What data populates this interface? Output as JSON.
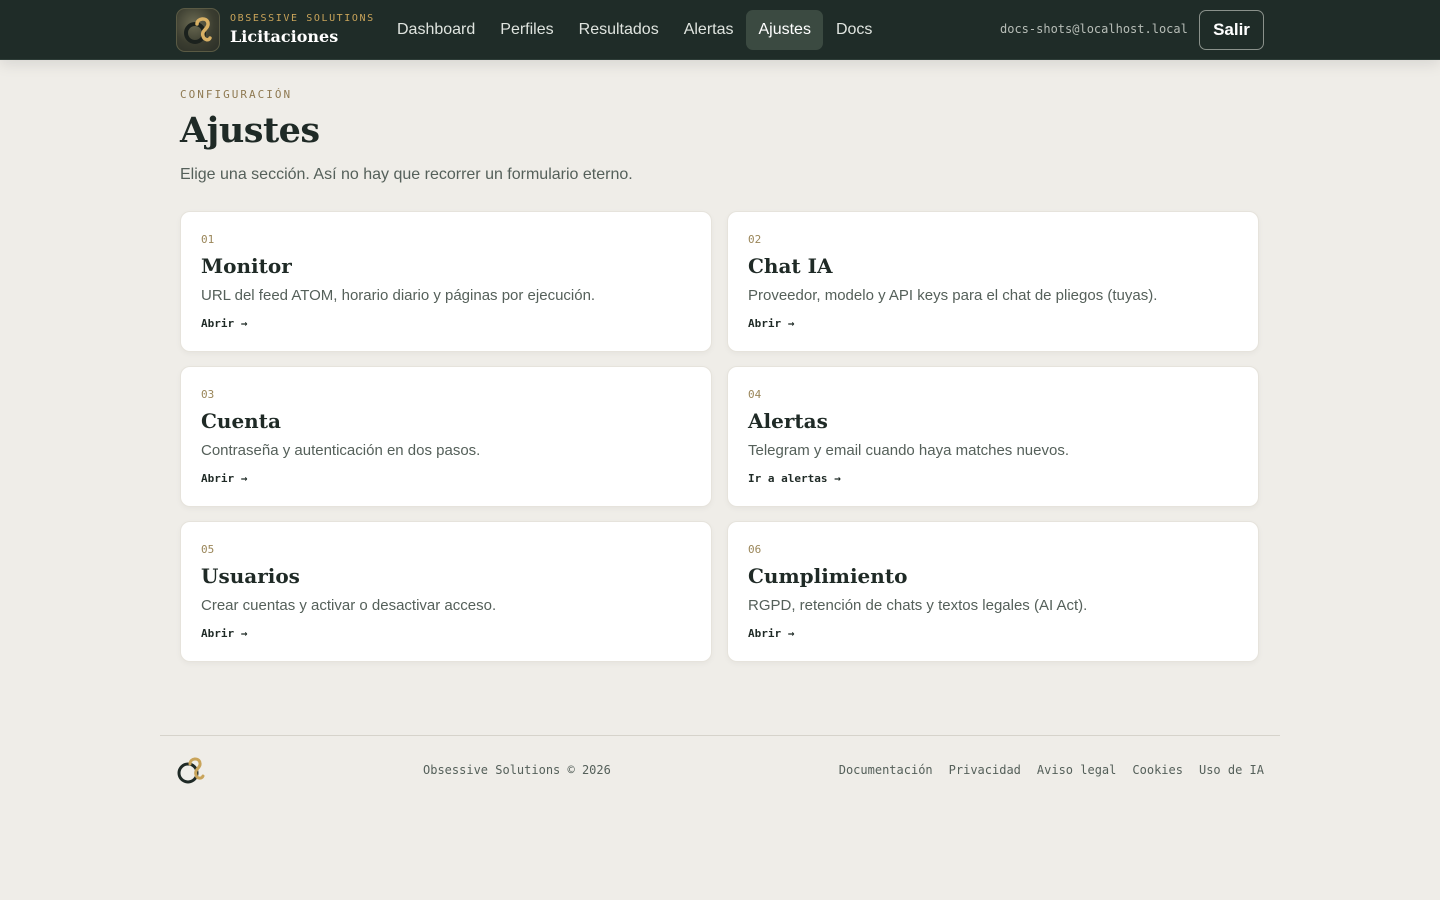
{
  "brand": {
    "kicker": "OBSESSIVE SOLUTIONS",
    "name": "Licitaciones",
    "logo_icon": "brand-logo-icon"
  },
  "nav": {
    "items": [
      {
        "label": "Dashboard",
        "active": false
      },
      {
        "label": "Perfiles",
        "active": false
      },
      {
        "label": "Resultados",
        "active": false
      },
      {
        "label": "Alertas",
        "active": false
      },
      {
        "label": "Ajustes",
        "active": true
      },
      {
        "label": "Docs",
        "active": false
      }
    ]
  },
  "user": {
    "email": "docs-shots@localhost.local",
    "logout_label": "Salir"
  },
  "header": {
    "kicker": "CONFIGURACIÓN",
    "title": "Ajustes",
    "subtitle": "Elige una sección. Así no hay que recorrer un formulario eterno."
  },
  "cards": [
    {
      "num": "01",
      "title": "Monitor",
      "desc": "URL del feed ATOM, horario diario y páginas por ejecución.",
      "link": "Abrir →"
    },
    {
      "num": "02",
      "title": "Chat IA",
      "desc": "Proveedor, modelo y API keys para el chat de pliegos (tuyas).",
      "link": "Abrir →"
    },
    {
      "num": "03",
      "title": "Cuenta",
      "desc": "Contraseña y autenticación en dos pasos.",
      "link": "Abrir →"
    },
    {
      "num": "04",
      "title": "Alertas",
      "desc": "Telegram y email cuando haya matches nuevos.",
      "link": "Ir a alertas →"
    },
    {
      "num": "05",
      "title": "Usuarios",
      "desc": "Crear cuentas y activar o desactivar acceso.",
      "link": "Abrir →"
    },
    {
      "num": "06",
      "title": "Cumplimiento",
      "desc": "RGPD, retención de chats y textos legales (AI Act).",
      "link": "Abrir →"
    }
  ],
  "footer": {
    "copyright": "Obsessive Solutions © 2026",
    "links": [
      "Documentación",
      "Privacidad",
      "Aviso legal",
      "Cookies",
      "Uso de IA"
    ]
  },
  "colors": {
    "topbar": "#1f2c28",
    "background": "#efede8",
    "accent_gold": "#c9a45a",
    "active_nav": "#3b4a41"
  }
}
